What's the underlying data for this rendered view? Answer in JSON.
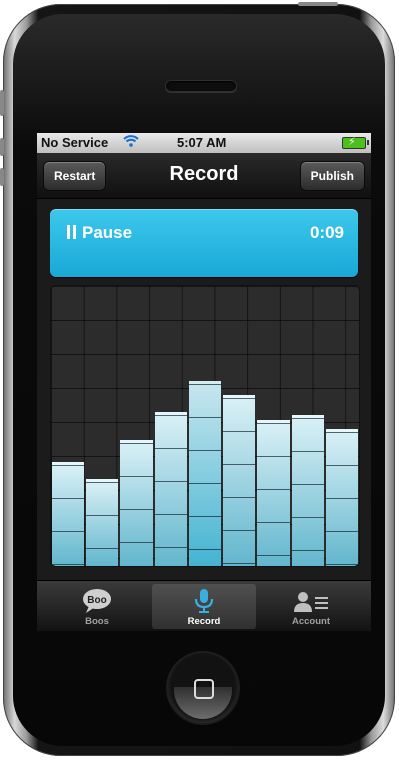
{
  "status_bar": {
    "carrier": "No Service",
    "time": "5:07 AM",
    "wifi_icon": "wifi-icon",
    "battery_icon": "battery-charging-icon"
  },
  "navbar": {
    "left_button": "Restart",
    "title": "Record",
    "right_button": "Publish"
  },
  "recording": {
    "control_label": "Pause",
    "control_icon": "pause-icon",
    "elapsed": "0:09",
    "accent_color": "#2bb8e2"
  },
  "meter": {
    "levels": [
      0.36,
      0.3,
      0.44,
      0.54,
      0.65,
      0.6,
      0.51,
      0.53,
      0.48
    ],
    "bar_color": "#8ccfe0"
  },
  "tabs": [
    {
      "label": "Boos",
      "icon": "boo-speech-bubble-icon",
      "active": false
    },
    {
      "label": "Record",
      "icon": "microphone-icon",
      "active": true
    },
    {
      "label": "Account",
      "icon": "account-list-icon",
      "active": false
    }
  ]
}
